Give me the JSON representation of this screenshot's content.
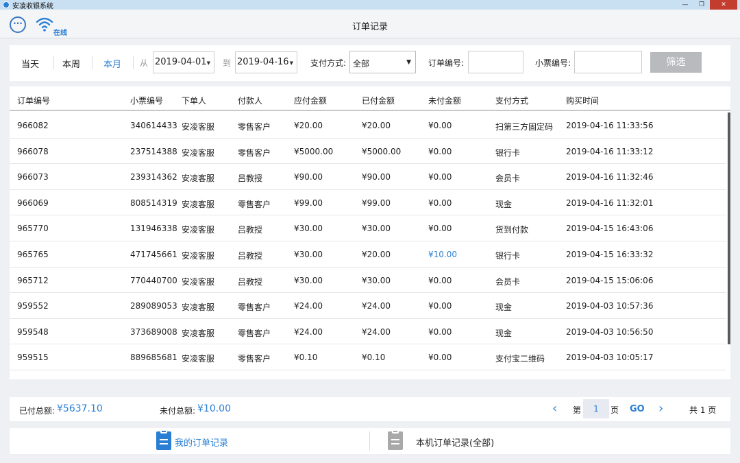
{
  "window": {
    "title": "安凌收银系统",
    "controls": [
      "—",
      "❐",
      "✕"
    ]
  },
  "header": {
    "page_title": "订单记录",
    "status": "在线"
  },
  "filters": {
    "quick": [
      "当天",
      "本周",
      "本月"
    ],
    "from_label": "从",
    "from_date": "2019-04-01",
    "to_label": "到",
    "to_date": "2019-04-16",
    "pay_method_label": "支付方式:",
    "pay_method_value": "全部",
    "order_no_label": "订单编号:",
    "ticket_no_label": "小票编号:",
    "filter_button": "筛选"
  },
  "table": {
    "columns": [
      "订单编号",
      "小票编号",
      "下单人",
      "付款人",
      "应付金额",
      "已付金额",
      "未付金额",
      "支付方式",
      "购买时间"
    ],
    "rows": [
      [
        "966082",
        "340614433",
        "安凌客服",
        "零售客户",
        "¥20.00",
        "¥20.00",
        "¥0.00",
        "扫第三方固定码",
        "2019-04-16 11:33:56"
      ],
      [
        "966078",
        "237514388",
        "安凌客服",
        "零售客户",
        "¥5000.00",
        "¥5000.00",
        "¥0.00",
        "银行卡",
        "2019-04-16 11:33:12"
      ],
      [
        "966073",
        "239314362",
        "安凌客服",
        "吕教授",
        "¥90.00",
        "¥90.00",
        "¥0.00",
        "会员卡",
        "2019-04-16 11:32:46"
      ],
      [
        "966069",
        "808514319",
        "安凌客服",
        "零售客户",
        "¥99.00",
        "¥99.00",
        "¥0.00",
        "现金",
        "2019-04-16 11:32:01"
      ],
      [
        "965770",
        "131946338",
        "安凌客服",
        "吕教授",
        "¥30.00",
        "¥30.00",
        "¥0.00",
        "货到付款",
        "2019-04-15 16:43:06"
      ],
      [
        "965765",
        "471745661",
        "安凌客服",
        "吕教授",
        "¥30.00",
        "¥20.00",
        "¥10.00",
        "银行卡",
        "2019-04-15 16:33:32"
      ],
      [
        "965712",
        "770440700",
        "安凌客服",
        "吕教授",
        "¥30.00",
        "¥30.00",
        "¥0.00",
        "会员卡",
        "2019-04-15 15:06:06"
      ],
      [
        "959552",
        "289089053",
        "安凌客服",
        "零售客户",
        "¥24.00",
        "¥24.00",
        "¥0.00",
        "现金",
        "2019-04-03 10:57:36"
      ],
      [
        "959548",
        "373689008",
        "安凌客服",
        "零售客户",
        "¥24.00",
        "¥24.00",
        "¥0.00",
        "现金",
        "2019-04-03 10:56:50"
      ],
      [
        "959515",
        "889685681",
        "安凌客服",
        "零售客户",
        "¥0.10",
        "¥0.10",
        "¥0.00",
        "支付宝二维码",
        "2019-04-03 10:05:17"
      ]
    ],
    "unpaid_highlight_row": 5
  },
  "summary": {
    "paid_label": "已付总额:",
    "paid_value": "¥5637.10",
    "unpaid_label": "未付总额:",
    "unpaid_value": "¥10.00"
  },
  "pagination": {
    "page_prefix": "第",
    "current_page": "1",
    "page_suffix": "页",
    "go": "GO",
    "total": "共 1 页"
  },
  "tabs": [
    {
      "label": "我的订单记录",
      "active": true
    },
    {
      "label": "本机订单记录(全部)",
      "active": false
    }
  ],
  "colors": {
    "accent": "#2a7fd4",
    "filter_button": "#b8babd",
    "tab_inactive_icon": "#a9a9a9"
  }
}
